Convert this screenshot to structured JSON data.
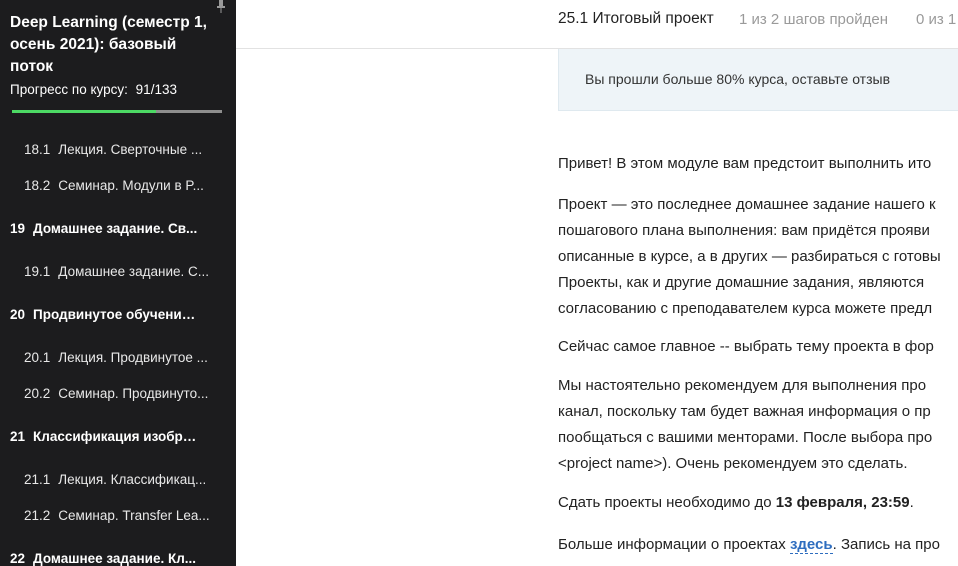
{
  "sidebar": {
    "course_title": "Deep Learning (семестр 1, осень 2021): базовый поток",
    "progress_label": "Прогресс по курсу:",
    "progress_value": "91/133",
    "progress_fraction": 0.684,
    "items": [
      {
        "num": "18.1",
        "label": "Лекция. Сверточные ...",
        "type": "sub"
      },
      {
        "num": "18.2",
        "label": "Семинар. Модули в P...",
        "type": "sub"
      },
      {
        "num": "19",
        "label": "Домашнее задание. Св...",
        "type": "module"
      },
      {
        "num": "19.1",
        "label": "Домашнее задание. С...",
        "type": "sub"
      },
      {
        "num": "20",
        "label": "Продвинутое обучение ...",
        "type": "module"
      },
      {
        "num": "20.1",
        "label": "Лекция. Продвинутое ...",
        "type": "sub"
      },
      {
        "num": "20.2",
        "label": "Семинар. Продвинуто...",
        "type": "sub"
      },
      {
        "num": "21",
        "label": "Классификация изобра...",
        "type": "module"
      },
      {
        "num": "21.1",
        "label": "Лекция. Классификац...",
        "type": "sub"
      },
      {
        "num": "21.2",
        "label": "Семинар. Transfer Lea...",
        "type": "sub"
      },
      {
        "num": "22",
        "label": "Домашнее задание. Кл...",
        "type": "module"
      }
    ]
  },
  "header": {
    "lesson_title": "25.1 Итоговый проект",
    "steps_status": "1 из 2 шагов пройден",
    "points_status": "0 из 1"
  },
  "notice": {
    "text": "Вы прошли больше 80% курса, оставьте отзыв"
  },
  "content": {
    "p1": "Привет! В этом модуле вам предстоит выполнить ито",
    "p2_lines": [
      "Проект — это последнее домашнее задание нашего к",
      "пошагового плана выполнения: вам придётся прояви",
      "описанные в курсе, а в других — разбираться с готовы",
      "Проекты, как и другие домашние задания, являются",
      "согласованию с преподавателем курса можете предл"
    ],
    "p3": "Сейчас самое главное -- выбрать тему проекта в фор",
    "p4_lines": [
      "Мы настоятельно рекомендуем для выполнения про",
      "канал, поскольку там будет важная информация о пр",
      "пообщаться с вашими менторами. После выбора про",
      "<project name>). Очень рекомендуем это сделать."
    ],
    "p5_prefix": "Сдать проекты необходимо до ",
    "p5_deadline": "13 февраля, 23:59",
    "p5_suffix": ".",
    "p6_prefix": "Больше информации о проектах ",
    "p6_link": "здесь",
    "p6_suffix": ". Запись на про"
  },
  "colors": {
    "sidebar_bg": "#1c1c1e",
    "progress_fill": "#4cd964",
    "link": "#2e6dbf",
    "notice_bg": "#eef4f8"
  }
}
